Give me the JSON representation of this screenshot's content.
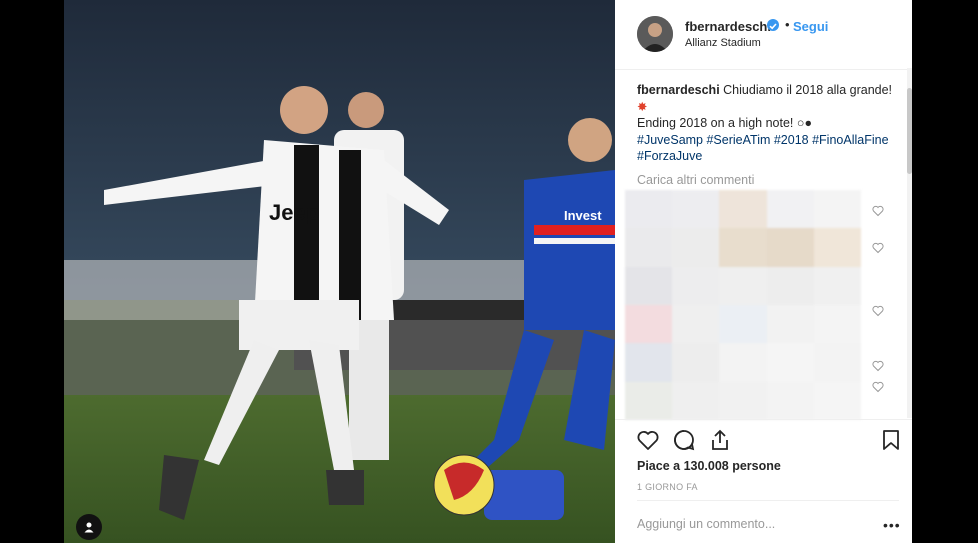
{
  "post": {
    "username": "fbernardeschi",
    "follow_label": "Segui",
    "separator": "•",
    "location": "Allianz Stadium",
    "caption_user": "fbernardeschi",
    "caption_line1": "Chiudiamo il 2018 alla grande!",
    "caption_line2": "Ending 2018 on a high note!",
    "hashtags": "#JuveSamp #SerieATim #2018 #FinoAllaFine #ForzaJuve",
    "load_more": "Carica altri commenti",
    "likes": "Piace a 130.008 persone",
    "time": "1 GIORNO FA",
    "add_comment_placeholder": "Aggiungi un commento...",
    "more_options": "•••"
  },
  "photo": {
    "shirt_text": "Jeep",
    "sponsor_text": "Invest"
  },
  "icons": {
    "verified": "verified-badge-icon",
    "heart": "heart-icon",
    "comment": "comment-icon",
    "share": "share-icon",
    "bookmark": "bookmark-icon",
    "user_tag": "user-tag-icon"
  },
  "colors": {
    "link": "#3897f0",
    "hashtag": "#003569",
    "muted": "#999999",
    "text": "#262626"
  }
}
